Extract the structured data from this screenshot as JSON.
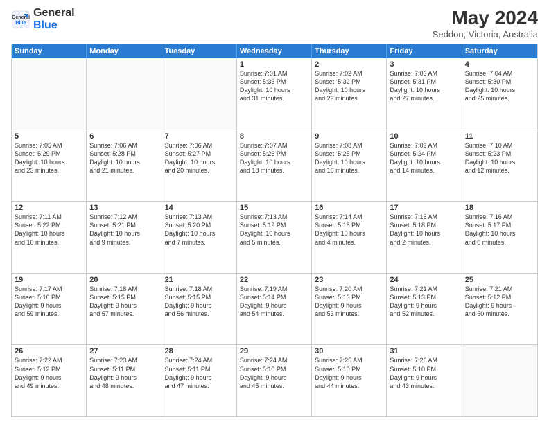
{
  "header": {
    "logo_general": "General",
    "logo_blue": "Blue",
    "month_year": "May 2024",
    "location": "Seddon, Victoria, Australia"
  },
  "days_of_week": [
    "Sunday",
    "Monday",
    "Tuesday",
    "Wednesday",
    "Thursday",
    "Friday",
    "Saturday"
  ],
  "weeks": [
    [
      {
        "day": "",
        "info": ""
      },
      {
        "day": "",
        "info": ""
      },
      {
        "day": "",
        "info": ""
      },
      {
        "day": "1",
        "info": "Sunrise: 7:01 AM\nSunset: 5:33 PM\nDaylight: 10 hours\nand 31 minutes."
      },
      {
        "day": "2",
        "info": "Sunrise: 7:02 AM\nSunset: 5:32 PM\nDaylight: 10 hours\nand 29 minutes."
      },
      {
        "day": "3",
        "info": "Sunrise: 7:03 AM\nSunset: 5:31 PM\nDaylight: 10 hours\nand 27 minutes."
      },
      {
        "day": "4",
        "info": "Sunrise: 7:04 AM\nSunset: 5:30 PM\nDaylight: 10 hours\nand 25 minutes."
      }
    ],
    [
      {
        "day": "5",
        "info": "Sunrise: 7:05 AM\nSunset: 5:29 PM\nDaylight: 10 hours\nand 23 minutes."
      },
      {
        "day": "6",
        "info": "Sunrise: 7:06 AM\nSunset: 5:28 PM\nDaylight: 10 hours\nand 21 minutes."
      },
      {
        "day": "7",
        "info": "Sunrise: 7:06 AM\nSunset: 5:27 PM\nDaylight: 10 hours\nand 20 minutes."
      },
      {
        "day": "8",
        "info": "Sunrise: 7:07 AM\nSunset: 5:26 PM\nDaylight: 10 hours\nand 18 minutes."
      },
      {
        "day": "9",
        "info": "Sunrise: 7:08 AM\nSunset: 5:25 PM\nDaylight: 10 hours\nand 16 minutes."
      },
      {
        "day": "10",
        "info": "Sunrise: 7:09 AM\nSunset: 5:24 PM\nDaylight: 10 hours\nand 14 minutes."
      },
      {
        "day": "11",
        "info": "Sunrise: 7:10 AM\nSunset: 5:23 PM\nDaylight: 10 hours\nand 12 minutes."
      }
    ],
    [
      {
        "day": "12",
        "info": "Sunrise: 7:11 AM\nSunset: 5:22 PM\nDaylight: 10 hours\nand 10 minutes."
      },
      {
        "day": "13",
        "info": "Sunrise: 7:12 AM\nSunset: 5:21 PM\nDaylight: 10 hours\nand 9 minutes."
      },
      {
        "day": "14",
        "info": "Sunrise: 7:13 AM\nSunset: 5:20 PM\nDaylight: 10 hours\nand 7 minutes."
      },
      {
        "day": "15",
        "info": "Sunrise: 7:13 AM\nSunset: 5:19 PM\nDaylight: 10 hours\nand 5 minutes."
      },
      {
        "day": "16",
        "info": "Sunrise: 7:14 AM\nSunset: 5:18 PM\nDaylight: 10 hours\nand 4 minutes."
      },
      {
        "day": "17",
        "info": "Sunrise: 7:15 AM\nSunset: 5:18 PM\nDaylight: 10 hours\nand 2 minutes."
      },
      {
        "day": "18",
        "info": "Sunrise: 7:16 AM\nSunset: 5:17 PM\nDaylight: 10 hours\nand 0 minutes."
      }
    ],
    [
      {
        "day": "19",
        "info": "Sunrise: 7:17 AM\nSunset: 5:16 PM\nDaylight: 9 hours\nand 59 minutes."
      },
      {
        "day": "20",
        "info": "Sunrise: 7:18 AM\nSunset: 5:15 PM\nDaylight: 9 hours\nand 57 minutes."
      },
      {
        "day": "21",
        "info": "Sunrise: 7:18 AM\nSunset: 5:15 PM\nDaylight: 9 hours\nand 56 minutes."
      },
      {
        "day": "22",
        "info": "Sunrise: 7:19 AM\nSunset: 5:14 PM\nDaylight: 9 hours\nand 54 minutes."
      },
      {
        "day": "23",
        "info": "Sunrise: 7:20 AM\nSunset: 5:13 PM\nDaylight: 9 hours\nand 53 minutes."
      },
      {
        "day": "24",
        "info": "Sunrise: 7:21 AM\nSunset: 5:13 PM\nDaylight: 9 hours\nand 52 minutes."
      },
      {
        "day": "25",
        "info": "Sunrise: 7:21 AM\nSunset: 5:12 PM\nDaylight: 9 hours\nand 50 minutes."
      }
    ],
    [
      {
        "day": "26",
        "info": "Sunrise: 7:22 AM\nSunset: 5:12 PM\nDaylight: 9 hours\nand 49 minutes."
      },
      {
        "day": "27",
        "info": "Sunrise: 7:23 AM\nSunset: 5:11 PM\nDaylight: 9 hours\nand 48 minutes."
      },
      {
        "day": "28",
        "info": "Sunrise: 7:24 AM\nSunset: 5:11 PM\nDaylight: 9 hours\nand 47 minutes."
      },
      {
        "day": "29",
        "info": "Sunrise: 7:24 AM\nSunset: 5:10 PM\nDaylight: 9 hours\nand 45 minutes."
      },
      {
        "day": "30",
        "info": "Sunrise: 7:25 AM\nSunset: 5:10 PM\nDaylight: 9 hours\nand 44 minutes."
      },
      {
        "day": "31",
        "info": "Sunrise: 7:26 AM\nSunset: 5:10 PM\nDaylight: 9 hours\nand 43 minutes."
      },
      {
        "day": "",
        "info": ""
      }
    ]
  ]
}
